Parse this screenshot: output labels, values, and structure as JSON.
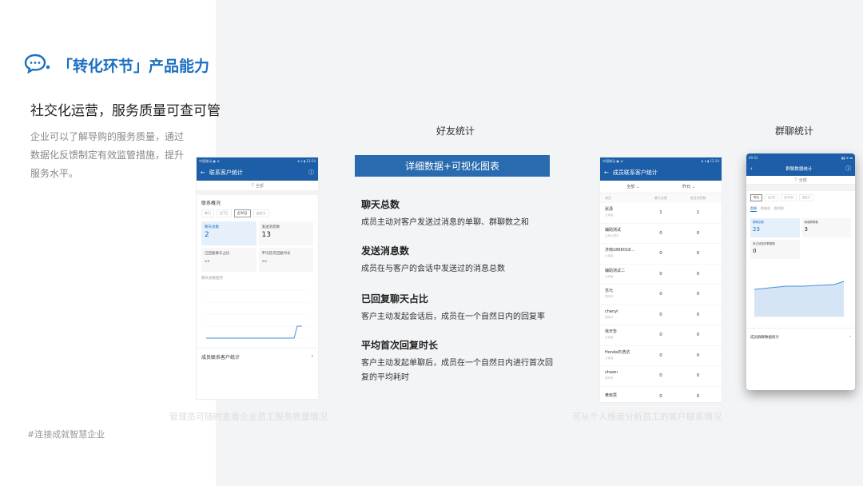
{
  "header": {
    "title": "「转化环节」产品能力",
    "subtitle": "社交化运营，服务质量可查可管",
    "description": "企业可以了解导购的服务质量，通过数据化反馈制定有效监管措施，提升服务水平。",
    "hashtag": "#连接成就智慧企业"
  },
  "sections": {
    "friend_stats": "好友统计",
    "group_stats": "群聊统计"
  },
  "captions": {
    "left": "管理员可随时查看企业员工服务质量情况",
    "right": "可从个人维度分析员工的客户联系情况"
  },
  "banner": "详细数据+可视化图表",
  "metrics": [
    {
      "title": "聊天总数",
      "desc": "成员主动对客户发送过消息的单聊、群聊数之和"
    },
    {
      "title": "发送消息数",
      "desc": "成员在与客户的会话中发送过的消息总数"
    },
    {
      "title": "已回复聊天占比",
      "desc": "客户主动发起会话后，成员在一个自然日内的回复率"
    },
    {
      "title": "平均首次回复时长",
      "desc": "客户主动发起单聊后，成员在一个自然日内进行首次回复的平均耗时"
    }
  ],
  "phone1": {
    "status_left": "中国移动 ▣ ⊕",
    "status_right": "⊕ ▾ ▮ 12:24",
    "nav_title": "联系客户统计",
    "filter": "全部",
    "section": "联系概况",
    "tabs": [
      "昨日",
      "近7日",
      "近30日",
      "自定义"
    ],
    "cards": [
      {
        "label": "聊天总数",
        "value": "2"
      },
      {
        "label": "发送消息数",
        "value": "13"
      },
      {
        "label": "已回复聊天占比",
        "value": "--"
      },
      {
        "label": "平均首次回复时长",
        "value": "--"
      }
    ],
    "chart_title": "聊天总数趋势",
    "bottom_row": "成员联系客户统计"
  },
  "phone2": {
    "status_left": "中国移动 ▣ ⊕",
    "status_right": "⊕ ▾ ▮ 12:24",
    "nav_title": "成员联系客户统计",
    "filter_left": "全部",
    "filter_right": "昨日",
    "columns": [
      "成员",
      "聊天总数",
      "发送消息数"
    ],
    "rows": [
      {
        "name": "张潇",
        "sub": "云南省",
        "a": "1",
        "b": "1"
      },
      {
        "name": "辅助测试",
        "sub": "云南大理市",
        "a": "0",
        "b": "0"
      },
      {
        "name": "济南1866018...",
        "sub": "云南省",
        "a": "0",
        "b": "0"
      },
      {
        "name": "辅助测试二",
        "sub": "云南省",
        "a": "0",
        "b": "0"
      },
      {
        "name": "苏元",
        "sub": "昆明市",
        "a": "0",
        "b": "0"
      },
      {
        "name": "chenyi",
        "sub": "昆明市",
        "a": "0",
        "b": "0"
      },
      {
        "name": "徐天告",
        "sub": "云南省",
        "a": "0",
        "b": "0"
      },
      {
        "name": "Honda石浩访",
        "sub": "云南省",
        "a": "0",
        "b": "0"
      },
      {
        "name": "shawn",
        "sub": "昆明市",
        "a": "0",
        "b": "0"
      },
      {
        "name": "黄晓慧",
        "sub": "",
        "a": "0",
        "b": "0"
      }
    ]
  },
  "phone3": {
    "status_left": "09:41",
    "status_right": "▮▮ ⊕ ▬",
    "nav_title": "群聊数据统计",
    "filter": "全部",
    "tabs": [
      "昨日",
      "近7日",
      "近30日",
      "自定义"
    ],
    "sub_tabs": [
      "群聊",
      "群成员",
      "群消息"
    ],
    "cards": [
      {
        "label": "群聊总数",
        "value": "23"
      },
      {
        "label": "新增群聊数",
        "value": "3"
      },
      {
        "label": "有过消息的群聊数",
        "value": "0"
      }
    ],
    "bottom_row": "成员群聊数据统计"
  }
}
